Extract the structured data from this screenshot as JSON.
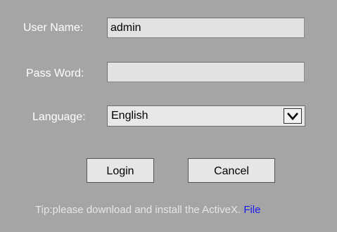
{
  "form": {
    "username": {
      "label": "User Name:",
      "value": "admin",
      "placeholder": ""
    },
    "password": {
      "label": "Pass Word:",
      "value": "",
      "placeholder": ""
    },
    "language": {
      "label": "Language:",
      "selected": "English"
    },
    "login_label": "Login",
    "cancel_label": "Cancel"
  },
  "tip": {
    "text": "Tip:please download and install the ActiveX.",
    "link_text": "File"
  },
  "icons": {
    "dropdown": "chevron-down-icon"
  },
  "colors": {
    "background": "#a5a5a5",
    "link": "#1c1cf0"
  }
}
